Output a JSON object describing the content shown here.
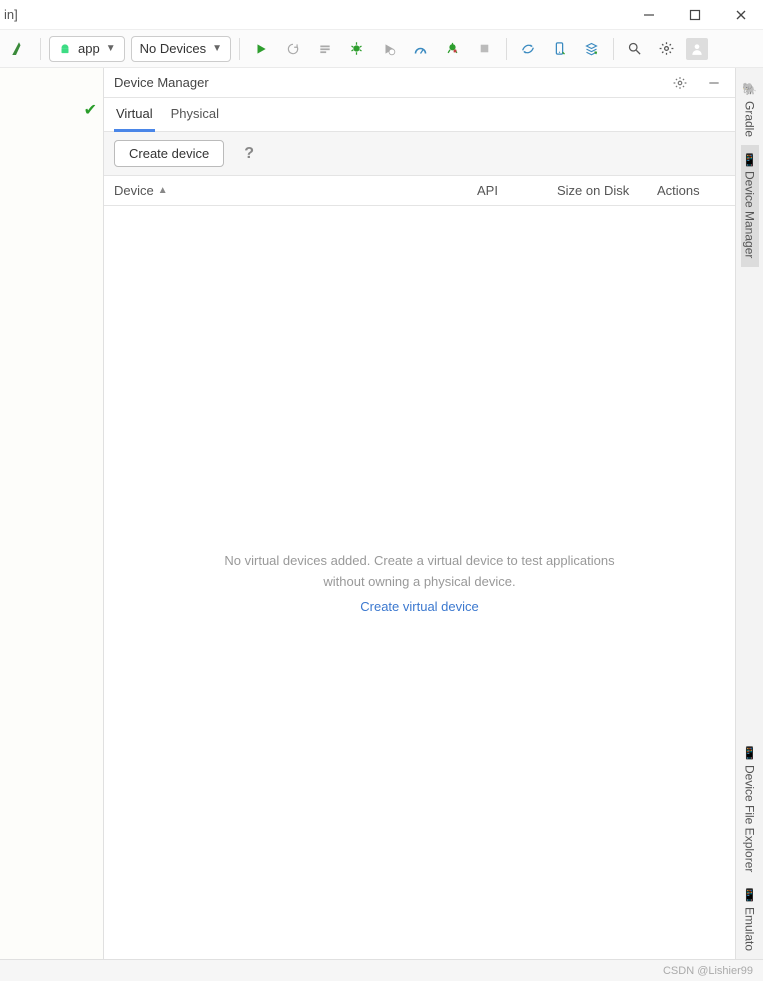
{
  "titlebar": {
    "suffix": "in]"
  },
  "toolbar": {
    "app_label": "app",
    "devices_label": "No Devices"
  },
  "panel": {
    "title": "Device Manager",
    "tabs": {
      "virtual": "Virtual",
      "physical": "Physical"
    },
    "create_button": "Create device",
    "columns": {
      "device": "Device",
      "api": "API",
      "size": "Size on Disk",
      "actions": "Actions"
    },
    "empty_msg": "No virtual devices added. Create a virtual device to test applications without owning a physical device.",
    "empty_link": "Create virtual device"
  },
  "rail": {
    "gradle": "Gradle",
    "device_manager": "Device Manager",
    "device_file_explorer": "Device File Explorer",
    "emulator": "Emulato"
  },
  "watermark": "CSDN @Lishier99"
}
